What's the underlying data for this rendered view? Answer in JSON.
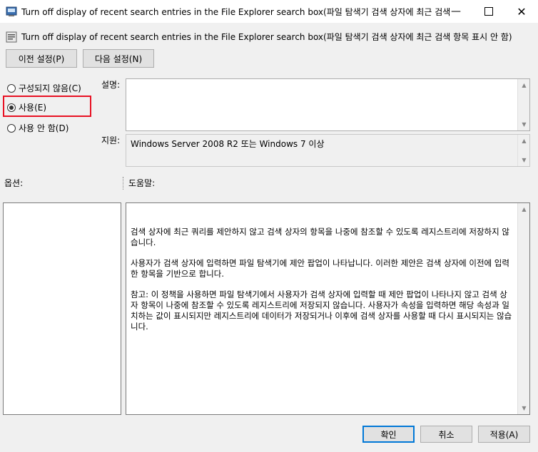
{
  "window": {
    "title": "Turn off display of recent search entries in the File Explorer search box(파일 탐색기 검색 상자에 최근 검색 ...",
    "minimize_icon": "minimize-icon",
    "maximize_icon": "maximize-icon",
    "close_icon": "close-icon"
  },
  "header": {
    "setting_title": "Turn off display of recent search entries in the File Explorer search box(파일 탐색기 검색 상자에 최근 검색 항목 표시 안 함)"
  },
  "nav": {
    "prev_label": "이전 설정(P)",
    "next_label": "다음 설정(N)"
  },
  "state": {
    "options": [
      {
        "label": "구성되지 않음(C)",
        "selected": false
      },
      {
        "label": "사용(E)",
        "selected": true
      },
      {
        "label": "사용 안 함(D)",
        "selected": false
      }
    ]
  },
  "comment": {
    "label": "설명:",
    "value": ""
  },
  "supported": {
    "label": "지원:",
    "value": "Windows Server 2008 R2 또는 Windows 7 이상"
  },
  "options_panel": {
    "label": "옵션:"
  },
  "help": {
    "label": "도움말:",
    "paragraphs": [
      "검색 상자에 최근 쿼리를 제안하지 않고 검색 상자의 항목을 나중에 참조할 수 있도록 레지스트리에 저장하지 않습니다.",
      "사용자가 검색 상자에 입력하면 파일 탐색기에 제안 팝업이 나타납니다.  이러한 제안은 검색 상자에 이전에 입력한 항목을 기반으로 합니다.",
      "참고: 이 정책을 사용하면 파일 탐색기에서 사용자가 검색 상자에 입력할 때 제안 팝업이 나타나지 않고 검색 상자 항목이 나중에 참조할 수 있도록 레지스트리에 저장되지 않습니다.  사용자가 속성을 입력하면 해당 속성과 일치하는 값이 표시되지만 레지스트리에 데이터가 저장되거나 이후에 검색 상자를 사용할 때 다시 표시되지는 않습니다."
    ]
  },
  "footer": {
    "ok_label": "확인",
    "cancel_label": "취소",
    "apply_label": "적용(A)"
  },
  "colors": {
    "highlight_box": "#e81123",
    "default_button_border": "#0078d7"
  }
}
